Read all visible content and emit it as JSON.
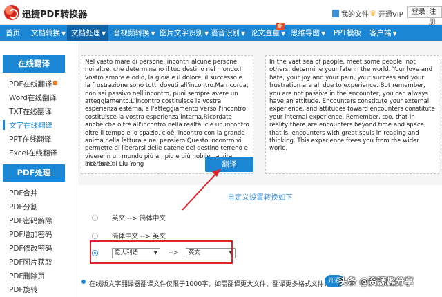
{
  "header": {
    "app_title": "迅捷PDF转换器",
    "my_files": "我的文件",
    "vip": "开通VIP",
    "login": "登录",
    "register": "注册"
  },
  "nav": [
    {
      "label": "首页",
      "caret": false
    },
    {
      "label": "文档转换",
      "caret": true
    },
    {
      "label": "文档处理",
      "caret": true,
      "active": true
    },
    {
      "label": "音视频转换",
      "caret": true
    },
    {
      "label": "图片文字识别",
      "caret": true
    },
    {
      "label": "语音识别",
      "caret": true
    },
    {
      "label": "论文查重",
      "caret": true
    },
    {
      "label": "思维导图",
      "caret": true
    },
    {
      "label": "PPT模板",
      "caret": false
    },
    {
      "label": "客户端",
      "caret": true
    }
  ],
  "nav_badge": "新",
  "sidebar": {
    "section1": "在线翻译",
    "items1": [
      "PDF在线翻译",
      "Word在线翻译",
      "TXT在线翻译",
      "文字在线翻译",
      "PPT在线翻译",
      "Excel在线翻译"
    ],
    "section2": "PDF处理",
    "items2": [
      "PDF合并",
      "PDF分割",
      "PDF密码解除",
      "PDF增加密码",
      "PDF修改密码",
      "PDF图片获取",
      "PDF删除页",
      "PDF旋转"
    ]
  },
  "source_text": "Nel vasto mare di persone, incontri alcune persone, noi altre, che determinano il tuo destino nel mondo.Il vostro amore e odio, la gioia e il dolore, il successo e la frustrazione sono tutti dovuti all'incontro.Ma ricorda, non sei passivo nell'incontro, puoi sempre avere un atteggiamento.L'incontro costituisce la vostra esperienza esterna, e l'atteggiamento verso l'incontro costituisce la vostra esperienza interna.Ricordate anche che oltre all'incontro nella realtà, c'è un incontro oltre il tempo e lo spazio, cioè, incontro con la grande anima nella lettura e nel pensiero.Questo incontro vi permette di liberarsi delle catene del destino terreno e vivere in un mondo più ampio e più nobile.La vita interiore di Liu Yong",
  "char_count": "617/2000",
  "translate_label": "翻译",
  "target_text": "In the vast sea of people, meet some people, not others, determine your fate in the world. Your love and hate, your joy and your pain, your success and your frustration are all due to experience. But remember, you are not passive in the encounter, you can always have an attitude. Encounters constitute your external experience, and attitudes toward encounters constitute your internal experience. Remember, too, that in reality there are encounters beyond time and space, that is, encounters with great souls in reading and thinking. This experience frees you from the wider world.",
  "settings": {
    "title": "自定义设置转换如下",
    "option1": "英文 --> 简体中文",
    "option2": "简体中文 --> 英文",
    "from_select": "意大利语",
    "arrow": "-->",
    "to_select": "英文"
  },
  "notice": {
    "text": "在线版文字翻译器翻译文件仅限于1000字，如需翻译更大文件、翻译更多格式文件，请",
    "button": "开通"
  },
  "watermark": "头条 @资源趣分享"
}
